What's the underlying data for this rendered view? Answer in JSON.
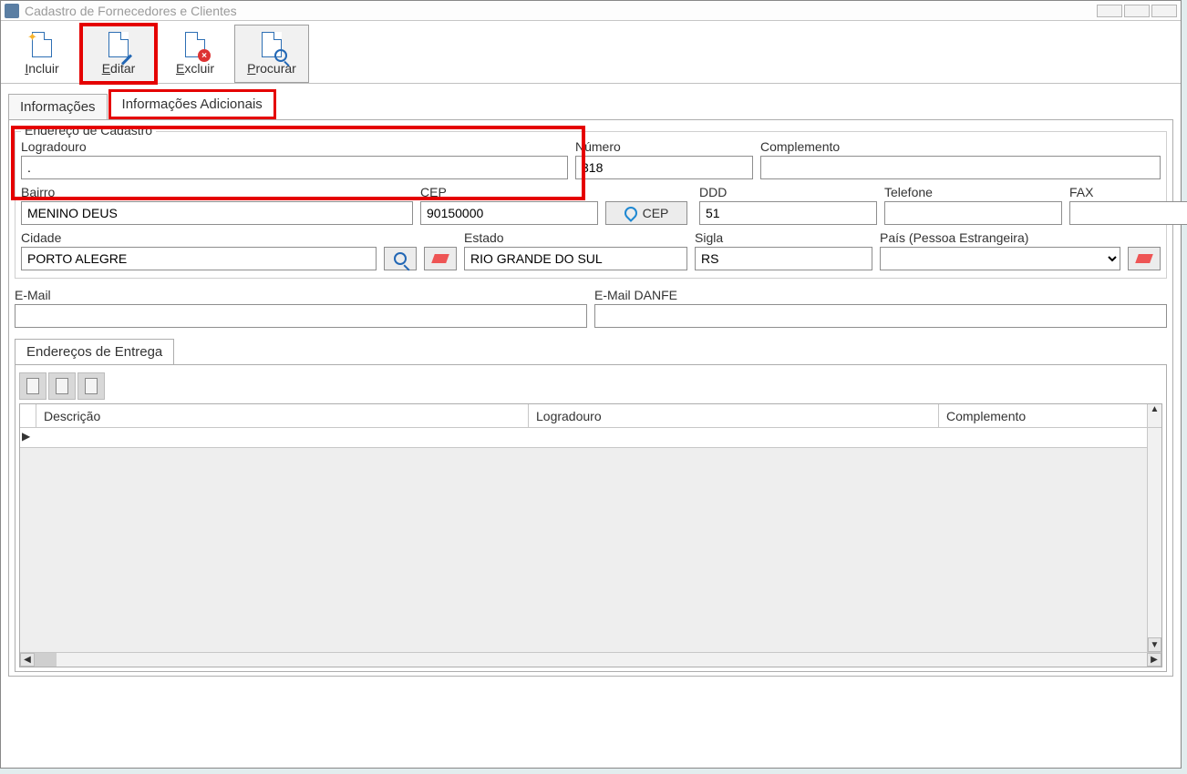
{
  "window": {
    "title": "Cadastro de Fornecedores e Clientes"
  },
  "toolbar": {
    "incluir": "Incluir",
    "editar": "Editar",
    "excluir": "Excluir",
    "procurar": "Procurar"
  },
  "tabs": {
    "informacoes": "Informações",
    "adicionais": "Informações Adicionais"
  },
  "group": {
    "legend": "Endereço de Cadastro",
    "logradouro_label": "Logradouro",
    "logradouro_value": ".",
    "numero_label": "Número",
    "numero_value": "318",
    "complemento_label": "Complemento",
    "complemento_value": "",
    "bairro_label": "Bairro",
    "bairro_value": "MENINO DEUS",
    "cep_label": "CEP",
    "cep_value": "90150000",
    "cep_button": "CEP",
    "ddd_label": "DDD",
    "ddd_value": "51",
    "telefone_label": "Telefone",
    "telefone_value": "",
    "fax_label": "FAX",
    "fax_value": "",
    "cidade_label": "Cidade",
    "cidade_value": "PORTO ALEGRE",
    "estado_label": "Estado",
    "estado_value": "RIO GRANDE DO SUL",
    "sigla_label": "Sigla",
    "sigla_value": "RS",
    "pais_label": "País (Pessoa Estrangeira)",
    "pais_value": ""
  },
  "email": {
    "label": "E-Mail",
    "value": "",
    "danfe_label": "E-Mail DANFE",
    "danfe_value": ""
  },
  "entrega": {
    "tab": "Endereços de Entrega",
    "columns": {
      "descricao": "Descrição",
      "logradouro": "Logradouro",
      "complemento": "Complemento"
    }
  }
}
